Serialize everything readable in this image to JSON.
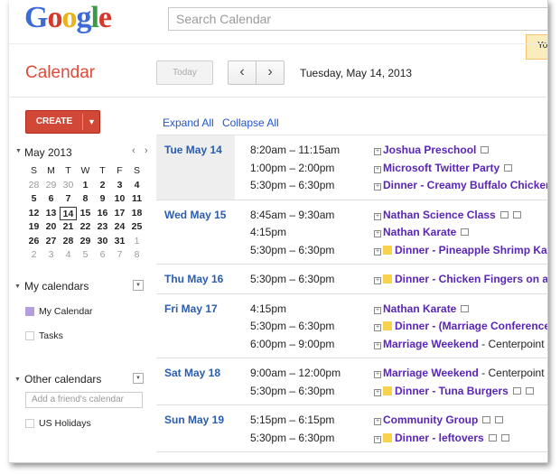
{
  "header": {
    "logo": [
      "G",
      "o",
      "o",
      "g",
      "l",
      "e"
    ],
    "search_placeholder": "Search Calendar",
    "notice_text": "Yo"
  },
  "app_title": "Calendar",
  "toolbar": {
    "today_label": "Today",
    "prev_label": "‹",
    "next_label": "›",
    "date_range": "Tuesday, May 14, 2013"
  },
  "sidebar": {
    "create_label": "CREATE",
    "create_dropdown": "▼",
    "mini_calendar": {
      "title": "May 2013",
      "prev": "‹",
      "next": "›",
      "weekdays": [
        "S",
        "M",
        "T",
        "W",
        "T",
        "F",
        "S"
      ],
      "weeks": [
        [
          [
            "28",
            "o"
          ],
          [
            "29",
            "o"
          ],
          [
            "30",
            "o"
          ],
          [
            "1",
            "m"
          ],
          [
            "2",
            "m"
          ],
          [
            "3",
            "m"
          ],
          [
            "4",
            "m"
          ]
        ],
        [
          [
            "5",
            "m"
          ],
          [
            "6",
            "m"
          ],
          [
            "7",
            "m"
          ],
          [
            "8",
            "m"
          ],
          [
            "9",
            "m"
          ],
          [
            "10",
            "m"
          ],
          [
            "11",
            "m"
          ]
        ],
        [
          [
            "12",
            "m"
          ],
          [
            "13",
            "m"
          ],
          [
            "14",
            "sel"
          ],
          [
            "15",
            "m"
          ],
          [
            "16",
            "m"
          ],
          [
            "17",
            "m"
          ],
          [
            "18",
            "m"
          ]
        ],
        [
          [
            "19",
            "m"
          ],
          [
            "20",
            "m"
          ],
          [
            "21",
            "m"
          ],
          [
            "22",
            "m"
          ],
          [
            "23",
            "m"
          ],
          [
            "24",
            "m"
          ],
          [
            "25",
            "m"
          ]
        ],
        [
          [
            "26",
            "m"
          ],
          [
            "27",
            "m"
          ],
          [
            "28",
            "m"
          ],
          [
            "29",
            "m"
          ],
          [
            "30",
            "m"
          ],
          [
            "31",
            "m"
          ],
          [
            "1",
            "o"
          ]
        ],
        [
          [
            "2",
            "o"
          ],
          [
            "3",
            "o"
          ],
          [
            "4",
            "o"
          ],
          [
            "5",
            "o"
          ],
          [
            "6",
            "o"
          ],
          [
            "7",
            "o"
          ],
          [
            "8",
            "o"
          ]
        ]
      ]
    },
    "my_calendars": {
      "title": "My calendars",
      "items": [
        {
          "label": "My Calendar",
          "color": "#b39ddb"
        },
        {
          "label": "Tasks",
          "color": "#ffffff"
        }
      ]
    },
    "other_calendars": {
      "title": "Other calendars",
      "add_placeholder": "Add a friend's calendar",
      "items": [
        {
          "label": "US Holidays",
          "color": "#ffffff"
        }
      ]
    }
  },
  "agenda": {
    "expand_all": "Expand All",
    "collapse_all": "Collapse All",
    "days": [
      {
        "label": "Tue May 14",
        "today": true,
        "events": [
          {
            "time": "8:20am – 11:15am",
            "title": "Joshua Preschool",
            "location": "",
            "color": false,
            "icons": 1
          },
          {
            "time": "1:00pm – 2:00pm",
            "title": "Microsoft Twitter Party",
            "location": "",
            "color": false,
            "icons": 1
          },
          {
            "time": "5:30pm – 6:30pm",
            "title": "Dinner - Creamy Buffalo Chicken",
            "location": "",
            "color": false,
            "icons": 0
          }
        ]
      },
      {
        "label": "Wed May 15",
        "today": false,
        "events": [
          {
            "time": "8:45am – 9:30am",
            "title": "Nathan Science Class",
            "location": "",
            "color": false,
            "icons": 2
          },
          {
            "time": "4:15pm",
            "title": "Nathan Karate",
            "location": "",
            "color": false,
            "icons": 1
          },
          {
            "time": "5:30pm – 6:30pm",
            "title": "Dinner - Pineapple Shrimp Kab",
            "location": "",
            "color": true,
            "icons": 0
          }
        ]
      },
      {
        "label": "Thu May 16",
        "today": false,
        "events": [
          {
            "time": "5:30pm – 6:30pm",
            "title": "Dinner - Chicken Fingers on a",
            "location": "",
            "color": true,
            "icons": 0
          }
        ]
      },
      {
        "label": "Fri May 17",
        "today": false,
        "events": [
          {
            "time": "4:15pm",
            "title": "Nathan Karate",
            "location": "",
            "color": false,
            "icons": 1
          },
          {
            "time": "5:30pm – 6:30pm",
            "title": "Dinner - (Marriage Conference",
            "location": "",
            "color": true,
            "icons": 0
          },
          {
            "time": "6:00pm – 9:00pm",
            "title": "Marriage Weekend",
            "location": " - Centerpoint",
            "color": false,
            "icons": 0
          }
        ]
      },
      {
        "label": "Sat May 18",
        "today": false,
        "events": [
          {
            "time": "9:00am – 12:00pm",
            "title": "Marriage Weekend",
            "location": " - Centerpoint",
            "color": false,
            "icons": 0
          },
          {
            "time": "5:30pm – 6:30pm",
            "title": "Dinner - Tuna Burgers",
            "location": "",
            "color": true,
            "icons": 2
          }
        ]
      },
      {
        "label": "Sun May 19",
        "today": false,
        "events": [
          {
            "time": "5:15pm – 6:15pm",
            "title": "Community Group",
            "location": "",
            "color": false,
            "icons": 2
          },
          {
            "time": "5:30pm – 6:30pm",
            "title": "Dinner - leftovers",
            "location": "",
            "color": true,
            "icons": 2
          }
        ]
      }
    ]
  }
}
